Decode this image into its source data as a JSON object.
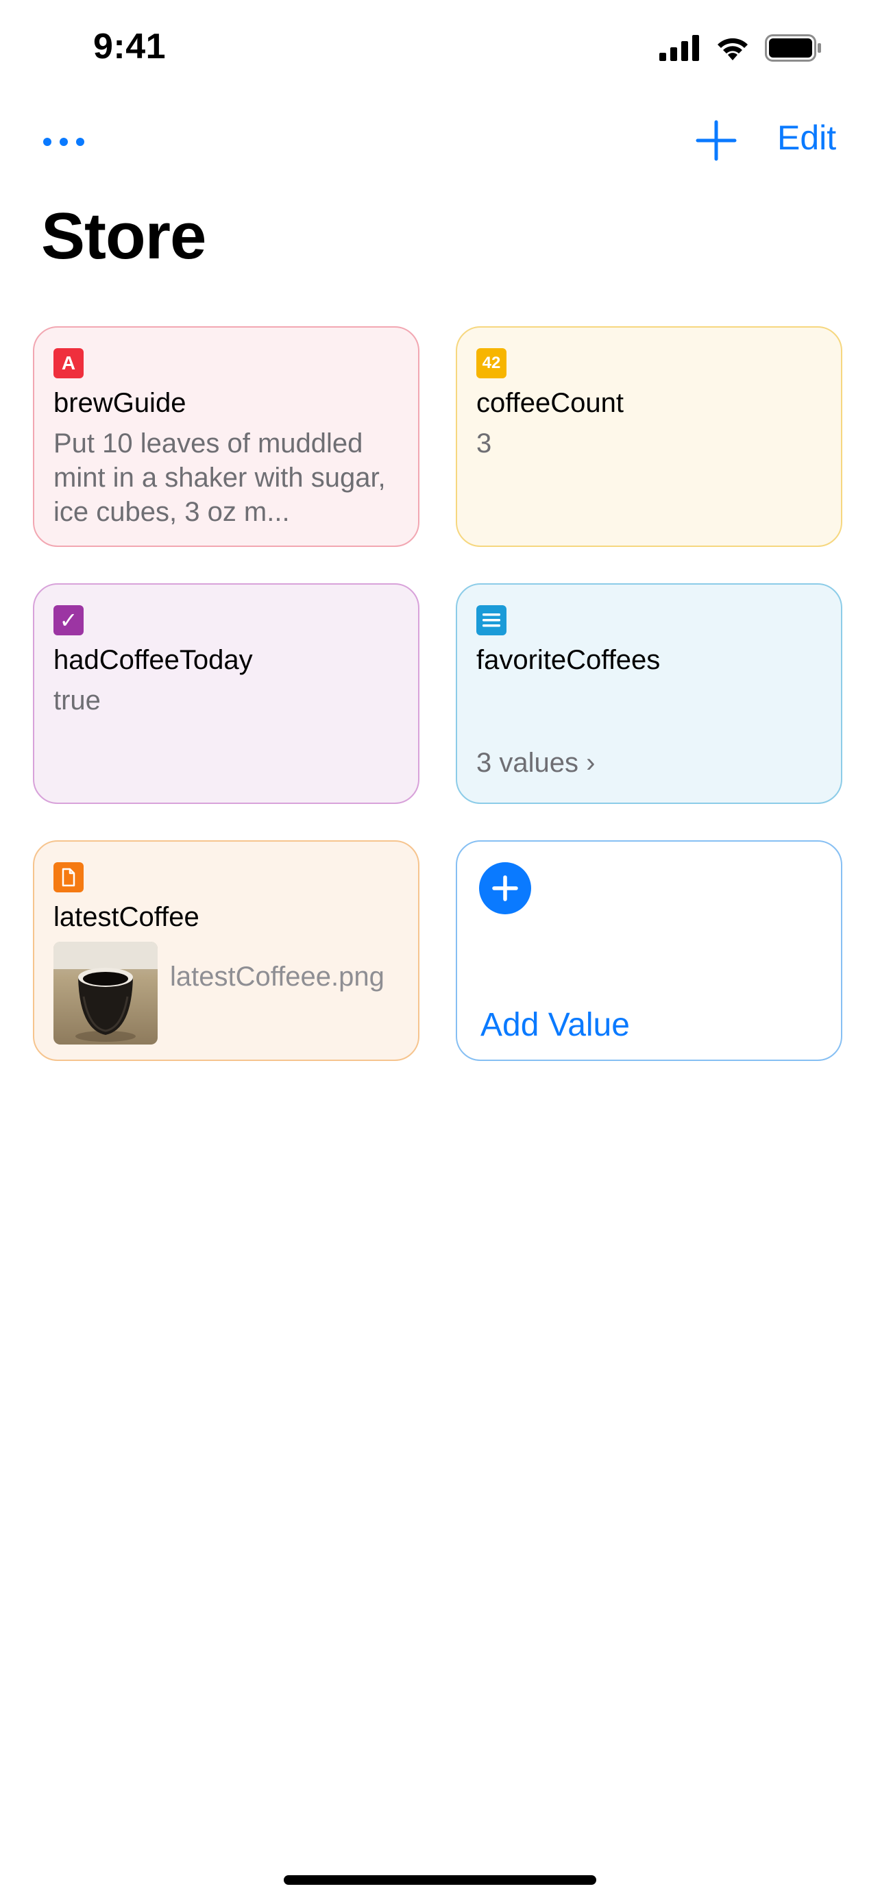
{
  "status_bar": {
    "time": "9:41"
  },
  "nav": {
    "edit_label": "Edit"
  },
  "page": {
    "title": "Store"
  },
  "colors": {
    "accent": "#0a7aff",
    "string_type": "#ef2f3d",
    "number_type": "#f7b500",
    "bool_type": "#9c35a3",
    "list_type": "#1b9bd8",
    "file_type": "#f57a12"
  },
  "cards": [
    {
      "icon": "string-type-icon",
      "icon_glyph": "A",
      "key": "brewGuide",
      "value": "Put 10 leaves of muddled mint in a shaker with sugar, ice cubes, 3 oz m..."
    },
    {
      "icon": "number-type-icon",
      "icon_glyph": "42",
      "key": "coffeeCount",
      "value": "3"
    },
    {
      "icon": "boolean-type-icon",
      "icon_glyph": "✓",
      "key": "hadCoffeeToday",
      "value": "true"
    },
    {
      "icon": "list-type-icon",
      "key": "favoriteCoffees",
      "value": "3 values ›"
    },
    {
      "icon": "file-type-icon",
      "key": "latestCoffee",
      "file_name": "latestCoffeee.png"
    }
  ],
  "add_value": {
    "label": "Add Value"
  }
}
